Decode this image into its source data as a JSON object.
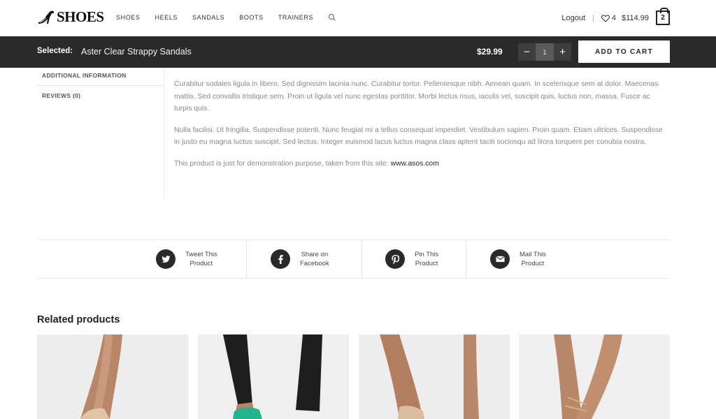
{
  "header": {
    "logo_text": "SHOES",
    "nav": [
      "SHOES",
      "HEELS",
      "SANDALS",
      "BOOTS",
      "TRAINERS"
    ],
    "logout": "Logout",
    "separator": "|",
    "wishlist_count": "4",
    "cart_total": "$114.99",
    "cart_count": "2"
  },
  "sticky_bar": {
    "selected_label": "Selected:",
    "product_name": "Aster Clear Strappy Sandals",
    "price": "$29.99",
    "qty_minus": "−",
    "qty_value": "1",
    "qty_plus": "+",
    "add_to_cart": "ADD TO CART"
  },
  "tabs": [
    {
      "label": "ADDITIONAL INFORMATION"
    },
    {
      "label": "REVIEWS (0)"
    }
  ],
  "description": {
    "p1": "Curabitur sodales ligula in libero. Sed dignissim lacinia nunc. Curabitur tortor. Pellentesque nibh. Aenean quam. In scelerisque sem at dolor. Maecenas mattis. Sed convallis tristique sem. Proin ut ligula vel nunc egestas porttitor. Morbi lectus risus, iaculis vel, suscipit quis, luctus non, massa. Fusce ac turpis quis.",
    "p2": "Nulla facilisi. Ut fringilla. Suspendisse potenti. Nunc feugiat mi a tellus consequat imperdiet. Vestibulum sapien. Proin quam. Etiam ultrices. Suspendisse in justo eu magna luctus suscipit. Sed lectus. Integer euismod lacus luctus magna class aptent taciti sociosqu ad litora torquent per conubia nostra.",
    "p3_prefix": "This product is just for demonstration purpose, taken from this site: ",
    "p3_link": "www.asos.com"
  },
  "share": [
    {
      "line1": "Tweet This",
      "line2": "Product",
      "icon": "twitter-icon"
    },
    {
      "line1": "Share on",
      "line2": "Facebook",
      "icon": "facebook-icon"
    },
    {
      "line1": "Pin This",
      "line2": "Product",
      "icon": "pinterest-icon"
    },
    {
      "line1": "Mail This",
      "line2": "Product",
      "icon": "mail-icon"
    }
  ],
  "related": {
    "title": "Related products",
    "items": [
      {
        "image": "product-image-nude-strappy-sandal"
      },
      {
        "image": "product-image-green-sandal-black-jeans"
      },
      {
        "image": "product-image-nude-heel"
      },
      {
        "image": "product-image-gold-strappy-sandal"
      }
    ]
  },
  "colors": {
    "sticky_bg": "#2a2a2a",
    "accent_green": "#1fb58f",
    "text_muted": "#888888"
  }
}
